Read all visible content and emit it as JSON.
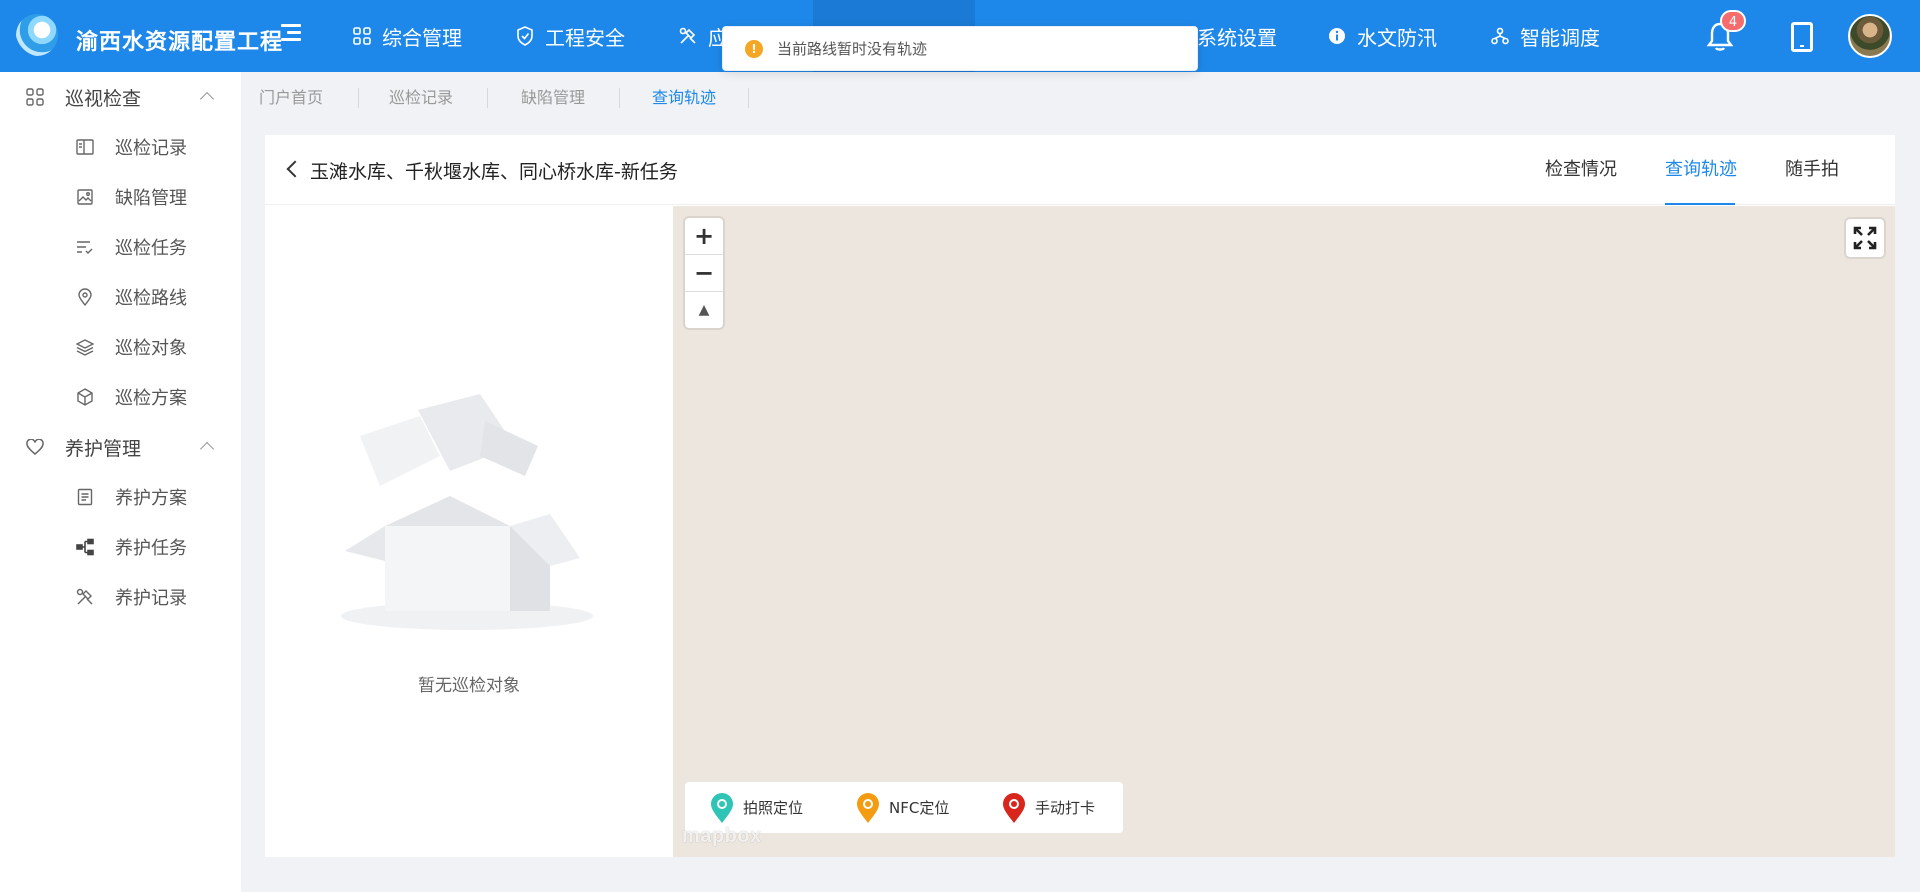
{
  "app": {
    "title": "渝西水资源配置工程"
  },
  "topnav": {
    "items": [
      {
        "label": "综合管理",
        "icon": "grid-icon"
      },
      {
        "label": "工程安全",
        "icon": "shield-icon"
      },
      {
        "label": "应",
        "icon": "tools-icon"
      },
      {
        "label": "系统设置",
        "icon": ""
      },
      {
        "label": "水文防汛",
        "icon": "info-icon"
      },
      {
        "label": "智能调度",
        "icon": "org-chart-icon"
      }
    ],
    "notification_count": "4"
  },
  "toast": {
    "message": "当前路线暂时没有轨迹"
  },
  "sidebar": {
    "groups": [
      {
        "label": "巡视检查",
        "icon": "apps-icon",
        "items": [
          {
            "label": "巡检记录",
            "icon": "book-icon"
          },
          {
            "label": "缺陷管理",
            "icon": "image-icon"
          },
          {
            "label": "巡检任务",
            "icon": "checklist-icon"
          },
          {
            "label": "巡检路线",
            "icon": "location-pin-icon"
          },
          {
            "label": "巡检对象",
            "icon": "layers-icon"
          },
          {
            "label": "巡检方案",
            "icon": "cube-icon"
          }
        ]
      },
      {
        "label": "养护管理",
        "icon": "heart-icon",
        "items": [
          {
            "label": "养护方案",
            "icon": "document-icon"
          },
          {
            "label": "养护任务",
            "icon": "hierarchy-icon"
          },
          {
            "label": "养护记录",
            "icon": "tools-icon"
          }
        ]
      }
    ]
  },
  "breadcrumbs": [
    {
      "label": "门户首页"
    },
    {
      "label": "巡检记录"
    },
    {
      "label": "缺陷管理"
    },
    {
      "label": "查询轨迹",
      "active": true
    }
  ],
  "task": {
    "title": "玉滩水库、千秋堰水库、同心桥水库-新任务",
    "tabs": [
      {
        "label": "检查情况"
      },
      {
        "label": "查询轨迹",
        "active": true
      },
      {
        "label": "随手拍"
      }
    ]
  },
  "empty_state": {
    "text": "暂无巡检对象"
  },
  "map": {
    "zoom_in": "+",
    "zoom_out": "−",
    "compass": "▲",
    "attribution": "mapbox",
    "legend": [
      {
        "label": "拍照定位",
        "color": "#2ec4b6"
      },
      {
        "label": "NFC定位",
        "color": "#f39c12"
      },
      {
        "label": "手动打卡",
        "color": "#d9261c"
      }
    ]
  },
  "colors": {
    "primary": "#1e88ea",
    "map_bg": "#ede6df",
    "badge": "#f56c6c"
  }
}
